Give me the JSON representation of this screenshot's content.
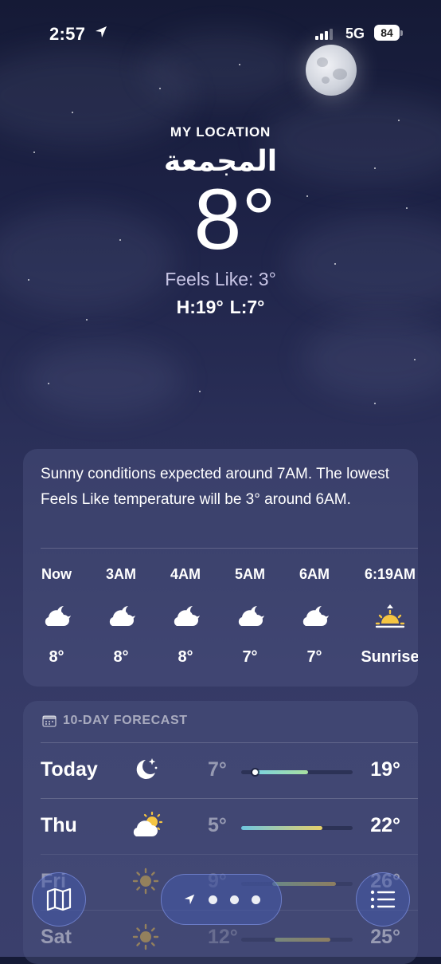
{
  "status_bar": {
    "time": "2:57",
    "network": "5G",
    "battery": "84",
    "icons": [
      "location-arrow-icon",
      "signal-icon",
      "battery-icon"
    ]
  },
  "header": {
    "label": "MY LOCATION",
    "city": "المجمعة",
    "temperature": "8°",
    "feels_like": "Feels Like: 3°",
    "high": "H:19°",
    "low": "L:7°"
  },
  "hourly": {
    "summary": "Sunny conditions expected around 7AM. The lowest Feels Like temperature will be 3° around 6AM.",
    "items": [
      {
        "label": "Now",
        "icon": "cloud-moon-icon",
        "temp": "8°"
      },
      {
        "label": "3AM",
        "icon": "cloud-moon-icon",
        "temp": "8°"
      },
      {
        "label": "4AM",
        "icon": "cloud-moon-icon",
        "temp": "8°"
      },
      {
        "label": "5AM",
        "icon": "cloud-moon-icon",
        "temp": "7°"
      },
      {
        "label": "6AM",
        "icon": "cloud-moon-icon",
        "temp": "7°"
      },
      {
        "label": "6:19AM",
        "icon": "sunrise-icon",
        "temp": "Sunrise"
      }
    ]
  },
  "forecast": {
    "title": "10-DAY FORECAST",
    "title_icon": "calendar-icon",
    "days": [
      {
        "day": "Today",
        "icon": "moon-stars-icon",
        "low": "7°",
        "high": "19°",
        "range_start": 0.12,
        "range_end": 0.6,
        "current": 0.12,
        "colors": [
          "#7ad3e0",
          "#a9e0a0"
        ]
      },
      {
        "day": "Thu",
        "icon": "cloud-sun-icon",
        "low": "5°",
        "high": "22°",
        "range_start": 0.0,
        "range_end": 0.73,
        "colors": [
          "#6fc6df",
          "#e6d06a"
        ]
      },
      {
        "day": "Fri",
        "icon": "sun-icon",
        "low": "9°",
        "high": "26°",
        "range_start": 0.28,
        "range_end": 0.85,
        "colors": [
          "#9ad6a0",
          "#e9c04a"
        ]
      },
      {
        "day": "Sat",
        "icon": "sun-icon",
        "low": "12°",
        "high": "25°",
        "range_start": 0.3,
        "range_end": 0.8,
        "colors": [
          "#b7d38a",
          "#e9c04a"
        ]
      }
    ]
  },
  "bottom_bar": {
    "map_icon": "map-icon",
    "location_icon": "location-arrow-icon",
    "list_icon": "list-icon",
    "pages": 3
  }
}
